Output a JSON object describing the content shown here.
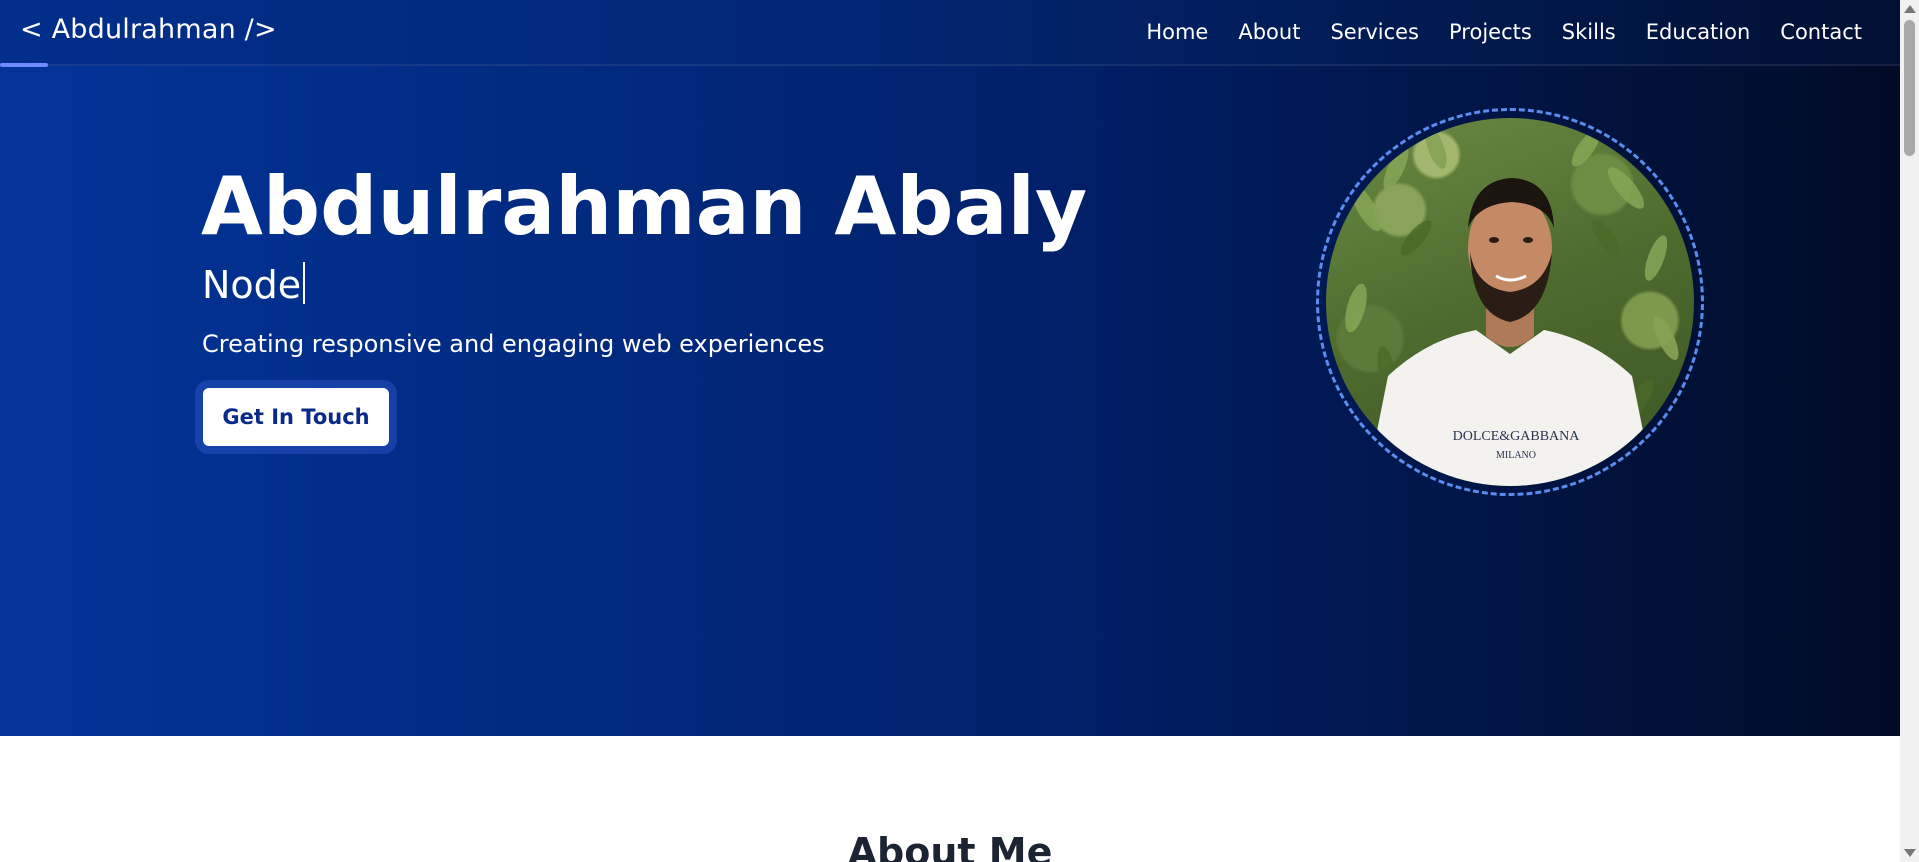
{
  "nav": {
    "logo": "< Abdulrahman />",
    "links": [
      "Home",
      "About",
      "Services",
      "Projects",
      "Skills",
      "Education",
      "Contact"
    ]
  },
  "hero": {
    "name": "Abdulrahman Abaly",
    "typed_text": "Node",
    "tagline": "Creating responsive and engaging web experiences",
    "cta_label": "Get In Touch",
    "shirt_brand": "DOLCE&GABBANA",
    "shirt_sub": "MILANO"
  },
  "about": {
    "title": "About Me"
  },
  "colors": {
    "accent": "#5b8cf0",
    "hero_start": "#023499",
    "hero_end": "#010b26"
  },
  "icons": {
    "scroll_up": "chevron-up-icon",
    "scroll_down": "chevron-down-icon"
  }
}
